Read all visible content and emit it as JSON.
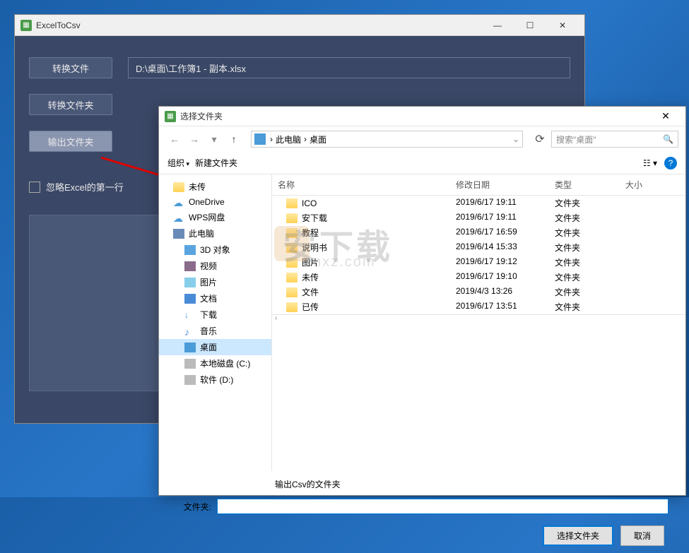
{
  "app": {
    "title": "ExcelToCsv",
    "convert_file_btn": "转换文件",
    "convert_folder_btn": "转换文件夹",
    "output_folder_btn": "输出文件夹",
    "file_path": "D:\\桌面\\工作簿1 - 副本.xlsx",
    "ignore_checkbox": "忽略Excel的第一行"
  },
  "dialog": {
    "title": "选择文件夹",
    "breadcrumb": {
      "root": "此电脑",
      "current": "桌面"
    },
    "search_placeholder": "搜索\"桌面\"",
    "organize": "组织",
    "new_folder": "新建文件夹",
    "columns": {
      "name": "名称",
      "date": "修改日期",
      "type": "类型",
      "size": "大小"
    },
    "tree": [
      {
        "label": "未传",
        "icon": "folder",
        "indent": false
      },
      {
        "label": "OneDrive",
        "icon": "cloud",
        "indent": false
      },
      {
        "label": "WPS网盘",
        "icon": "cloud",
        "indent": false
      },
      {
        "label": "此电脑",
        "icon": "pc",
        "indent": false
      },
      {
        "label": "3D 对象",
        "icon": "obj",
        "indent": true
      },
      {
        "label": "视频",
        "icon": "video",
        "indent": true
      },
      {
        "label": "图片",
        "icon": "img",
        "indent": true
      },
      {
        "label": "文档",
        "icon": "doc",
        "indent": true
      },
      {
        "label": "下载",
        "icon": "dl",
        "indent": true
      },
      {
        "label": "音乐",
        "icon": "music",
        "indent": true
      },
      {
        "label": "桌面",
        "icon": "blue",
        "indent": true,
        "selected": true
      },
      {
        "label": "本地磁盘 (C:)",
        "icon": "drive",
        "indent": true
      },
      {
        "label": "软件 (D:)",
        "icon": "drive",
        "indent": true
      }
    ],
    "files": [
      {
        "name": "ICO",
        "date": "2019/6/17 19:11",
        "type": "文件夹"
      },
      {
        "name": "安下载",
        "date": "2019/6/17 19:11",
        "type": "文件夹"
      },
      {
        "name": "教程",
        "date": "2019/6/17 16:59",
        "type": "文件夹"
      },
      {
        "name": "说明书",
        "date": "2019/6/14 15:33",
        "type": "文件夹"
      },
      {
        "name": "图片",
        "date": "2019/6/17 19:12",
        "type": "文件夹"
      },
      {
        "name": "未传",
        "date": "2019/6/17 19:10",
        "type": "文件夹"
      },
      {
        "name": "文件",
        "date": "2019/4/3 13:26",
        "type": "文件夹"
      },
      {
        "name": "已传",
        "date": "2019/6/17 13:51",
        "type": "文件夹"
      }
    ],
    "output_label": "输出Csv的文件夹",
    "folder_label": "文件夹:",
    "folder_value": "",
    "select_btn": "选择文件夹",
    "cancel_btn": "取消"
  },
  "watermark": {
    "text": "安下载",
    "sub": "anxz.com"
  }
}
